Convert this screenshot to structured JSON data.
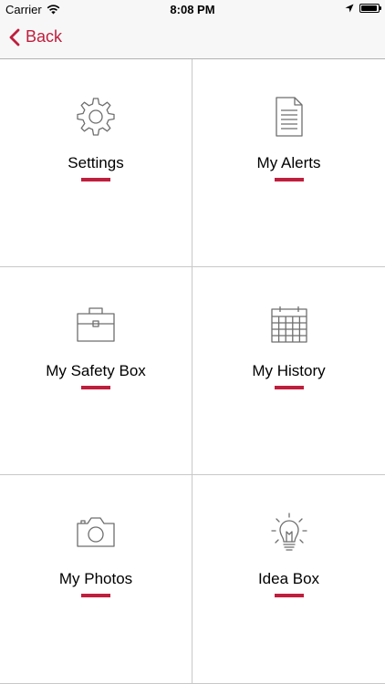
{
  "status_bar": {
    "carrier": "Carrier",
    "time": "8:08 PM",
    "battery_level": 0.95
  },
  "nav": {
    "back_label": "Back"
  },
  "colors": {
    "accent": "#bf1e3d",
    "divider": "#c8c8c8",
    "icon_stroke": "#6e6e6e"
  },
  "tiles": [
    {
      "label": "Settings",
      "icon": "gear-icon"
    },
    {
      "label": "My Alerts",
      "icon": "document-icon"
    },
    {
      "label": "My Safety Box",
      "icon": "toolbox-icon"
    },
    {
      "label": "My History",
      "icon": "calendar-icon"
    },
    {
      "label": "My Photos",
      "icon": "camera-icon"
    },
    {
      "label": "Idea Box",
      "icon": "lightbulb-icon"
    }
  ]
}
